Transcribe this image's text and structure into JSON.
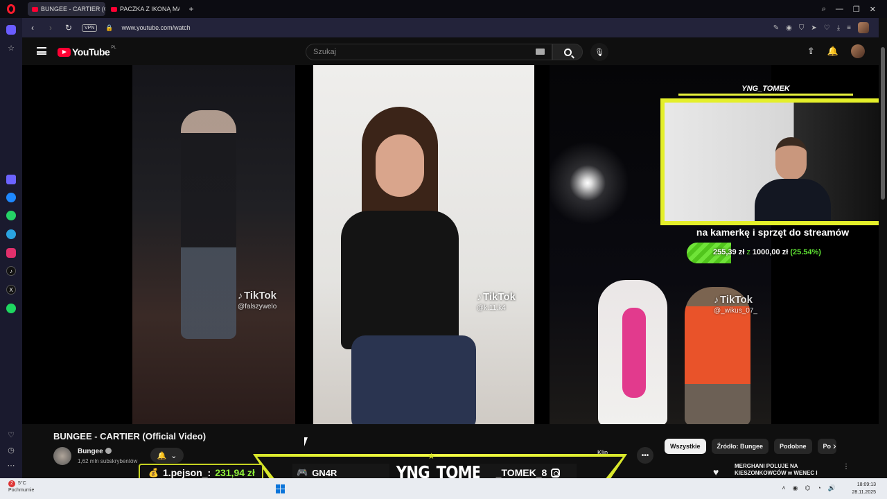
{
  "browser": {
    "tabs": [
      {
        "label": "BUNGEE - CARTIER (O"
      },
      {
        "label": "PACZKA Z IKONĄ MAX 91"
      }
    ],
    "vpn_label": "VPN",
    "url": "www.youtube.com/watch"
  },
  "youtube": {
    "logo_text": "YouTube",
    "logo_region": "PL",
    "search_placeholder": "Szukaj"
  },
  "player": {
    "clips": [
      {
        "brand": "TikTok",
        "handle": "@falszywelo"
      },
      {
        "brand": "TikTok",
        "handle": "@k.11.k4"
      },
      {
        "brand": "TikTok",
        "handle": "@_wikus_07_"
      }
    ]
  },
  "stream_overlay": {
    "cam_title": "YNG_TOMEK",
    "goal_text": "na kamerkę i sprzęt do streamów",
    "goal_current": "255,39 zł",
    "goal_separator": "z",
    "goal_target": "1000,00 zł",
    "goal_percent": "(25.54%)",
    "goal_fraction": 0.2554
  },
  "video": {
    "title": "BUNGEE - CARTIER (Official Video)",
    "channel": "Bungee",
    "subscribers": "1,62 mln subskrybentów",
    "clip_label": "Klip",
    "chips": [
      "Wszystkie",
      "Źródło: Bungee",
      "Podobne",
      "Po"
    ],
    "rec_title": "MERGHANI POLUJE NA KIESZONKOWCÓW w WENEC I"
  },
  "banner": {
    "donor_rank": "1.pejson_:",
    "donor_amount": "231,94 zł",
    "discord": "GN4R",
    "name": "YNG_TOMEK",
    "instagram": "_TOMEK_8"
  },
  "taskbar": {
    "notif_count": "2",
    "temp": "5°C",
    "weather": "Pochmurnie",
    "time": "18:09:13",
    "date": "28.11.2025"
  }
}
